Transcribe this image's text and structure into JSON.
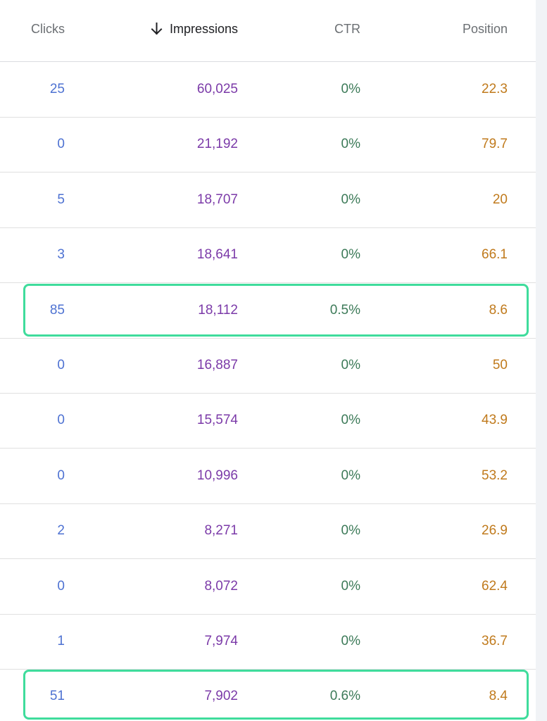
{
  "columns": {
    "clicks": "Clicks",
    "impressions": "Impressions",
    "ctr": "CTR",
    "position": "Position",
    "sort_icon": "arrow-down-icon"
  },
  "colors": {
    "clicks": "#4e72d2",
    "impressions": "#7b3aa8",
    "ctr": "#3c7a58",
    "position": "#c07a1c",
    "highlight": "#3fdc9c"
  },
  "rows": [
    {
      "clicks": "25",
      "impressions": "60,025",
      "ctr": "0%",
      "position": "22.3",
      "highlighted": false
    },
    {
      "clicks": "0",
      "impressions": "21,192",
      "ctr": "0%",
      "position": "79.7",
      "highlighted": false
    },
    {
      "clicks": "5",
      "impressions": "18,707",
      "ctr": "0%",
      "position": "20",
      "highlighted": false
    },
    {
      "clicks": "3",
      "impressions": "18,641",
      "ctr": "0%",
      "position": "66.1",
      "highlighted": false
    },
    {
      "clicks": "85",
      "impressions": "18,112",
      "ctr": "0.5%",
      "position": "8.6",
      "highlighted": true
    },
    {
      "clicks": "0",
      "impressions": "16,887",
      "ctr": "0%",
      "position": "50",
      "highlighted": false
    },
    {
      "clicks": "0",
      "impressions": "15,574",
      "ctr": "0%",
      "position": "43.9",
      "highlighted": false
    },
    {
      "clicks": "0",
      "impressions": "10,996",
      "ctr": "0%",
      "position": "53.2",
      "highlighted": false
    },
    {
      "clicks": "2",
      "impressions": "8,271",
      "ctr": "0%",
      "position": "26.9",
      "highlighted": false
    },
    {
      "clicks": "0",
      "impressions": "8,072",
      "ctr": "0%",
      "position": "62.4",
      "highlighted": false
    },
    {
      "clicks": "1",
      "impressions": "7,974",
      "ctr": "0%",
      "position": "36.7",
      "highlighted": false
    },
    {
      "clicks": "51",
      "impressions": "7,902",
      "ctr": "0.6%",
      "position": "8.4",
      "highlighted": true
    }
  ]
}
